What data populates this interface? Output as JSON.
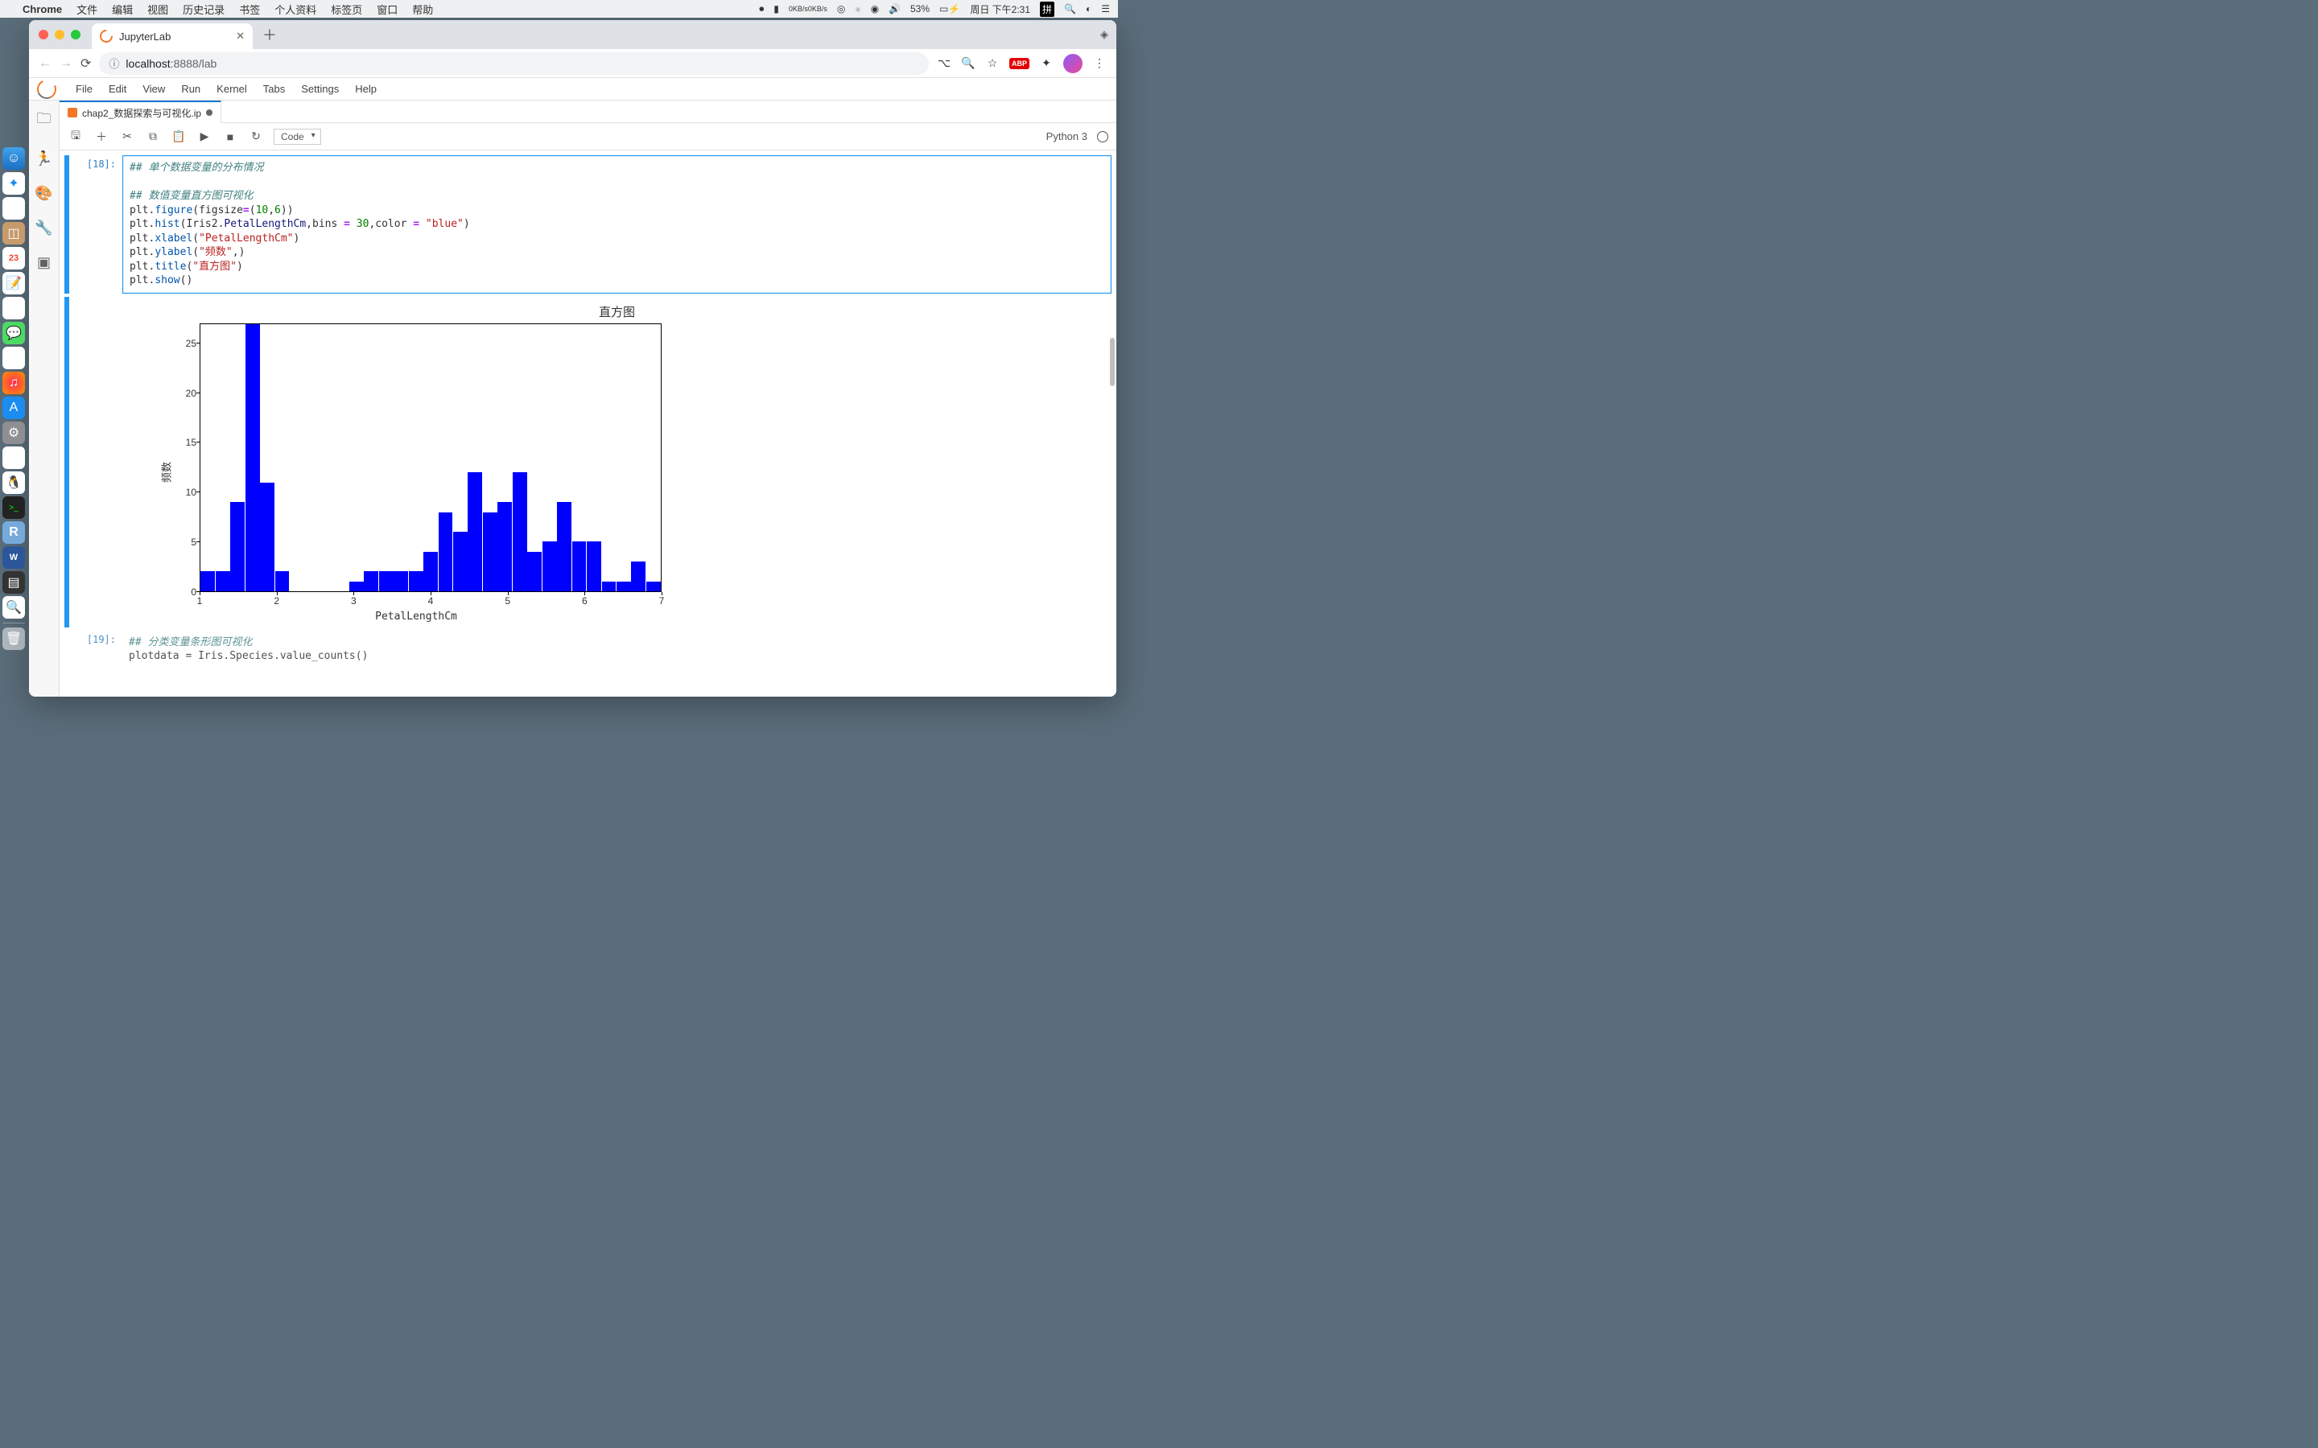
{
  "macmenu": {
    "app": "Chrome",
    "items": [
      "文件",
      "编辑",
      "视图",
      "历史记录",
      "书签",
      "个人资料",
      "标签页",
      "窗口",
      "帮助"
    ],
    "net_up": "0KB/s",
    "net_down": "0KB/s",
    "battery": "53%",
    "date": "周日 下午2:31",
    "ime": "拼"
  },
  "chrome": {
    "tab_title": "JupyterLab",
    "url_prefix": "localhost",
    "url_rest": ":8888/lab"
  },
  "jupyter": {
    "menus": [
      "File",
      "Edit",
      "View",
      "Run",
      "Kernel",
      "Tabs",
      "Settings",
      "Help"
    ],
    "tab": "chap2_数据探索与可视化.ip",
    "cell_type": "Code",
    "kernel": "Python 3",
    "prompt1": "[18]:",
    "prompt2": "[19]:",
    "code1_lines": {
      "c1": "## 单个数据变量的分布情况",
      "c2": "## 数值变量直方图可视化",
      "l1a": "plt.",
      "l1b": "figure",
      "l1c": "(figsize",
      "l1d": "=",
      "l1e": "(",
      "l1f": "10",
      "l1g": ",",
      "l1h": "6",
      "l1i": "))",
      "l2a": "plt.",
      "l2b": "hist",
      "l2c": "(Iris2.",
      "l2d": "PetalLengthCm",
      "l2e": ",bins ",
      "l2f": "=",
      "l2g": " ",
      "l2h": "30",
      "l2i": ",color ",
      "l2j": "=",
      "l2k": " ",
      "l2l": "\"blue\"",
      "l2m": ")",
      "l3a": "plt.",
      "l3b": "xlabel",
      "l3c": "(",
      "l3d": "\"PetalLengthCm\"",
      "l3e": ")",
      "l4a": "plt.",
      "l4b": "ylabel",
      "l4c": "(",
      "l4d": "\"频数\"",
      "l4e": ",)",
      "l5a": "plt.",
      "l5b": "title",
      "l5c": "(",
      "l5d": "\"直方图\"",
      "l5e": ")",
      "l6a": "plt.",
      "l6b": "show",
      "l6c": "()"
    },
    "code2_lines": {
      "c1": "## 分类变量条形图可视化",
      "l1": "plotdata = Iris.Species.value_counts()"
    }
  },
  "chart_data": {
    "type": "bar",
    "title": "直方图",
    "xlabel": "PetalLengthCm",
    "ylabel": "频数",
    "xlim": [
      1,
      7
    ],
    "ylim": [
      0,
      27
    ],
    "xticks": [
      1,
      2,
      3,
      4,
      5,
      6,
      7
    ],
    "yticks": [
      0,
      5,
      10,
      15,
      20,
      25
    ],
    "bins": 30,
    "bin_edges_approx": [
      1.0,
      1.2,
      1.4,
      1.6,
      1.8,
      2.0,
      2.2,
      2.4,
      2.6,
      2.8,
      3.0,
      3.2,
      3.4,
      3.6,
      3.8,
      4.0,
      4.2,
      4.4,
      4.6,
      4.8,
      5.0,
      5.2,
      5.4,
      5.6,
      5.8,
      6.0,
      6.2,
      6.4,
      6.6,
      6.8,
      7.0
    ],
    "values": [
      2,
      2,
      9,
      27,
      11,
      2,
      0,
      0,
      0,
      0,
      1,
      2,
      2,
      2,
      2,
      4,
      8,
      6,
      12,
      8,
      9,
      12,
      4,
      5,
      9,
      5,
      5,
      1,
      1,
      3,
      1
    ]
  }
}
